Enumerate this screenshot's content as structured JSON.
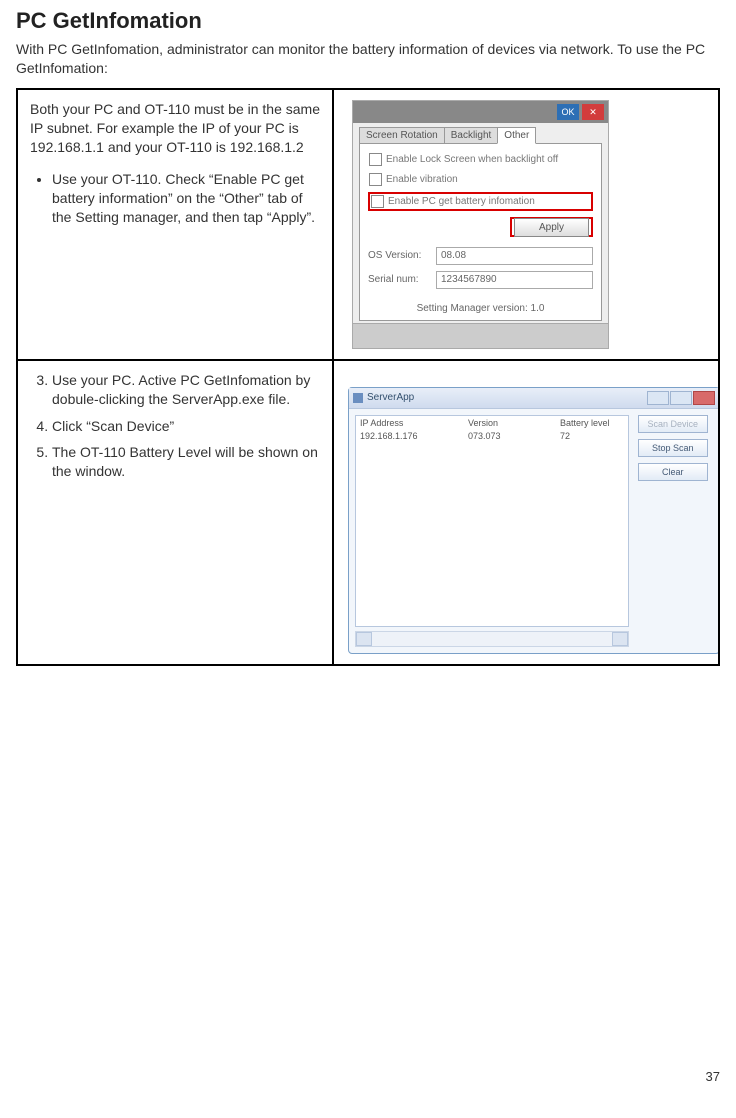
{
  "page": {
    "title": "PC GetInfomation",
    "lead": "With PC GetInfomation, administrator can monitor the battery information of devices via network. To use the PC GetInfomation:",
    "pageNumber": "37"
  },
  "row1": {
    "intro": "Both your PC and OT-110 must be in the same IP subnet. For example the IP of your PC is 192.168.1.1 and your OT-110 is 192.168.1.2",
    "bullet1": "Use your OT-110. Check “Enable PC get battery information” on the “Other” tab of the Setting manager, and then tap “Apply”."
  },
  "row2": {
    "step3": "Use your PC. Active PC GetInfomation by dobule-clicking the ServerApp.exe file.",
    "step4": "Click “Scan Device”",
    "step5": "The OT-110 Battery Level will be shown on the window."
  },
  "settingMgr": {
    "okLabel": "OK",
    "tab1": "Screen Rotation",
    "tab2": "Backlight",
    "tab3": "Other",
    "chkLockScreen": "Enable Lock Screen when backlight off",
    "chkVibration": "Enable vibration",
    "chkPCget": "Enable PC get battery infomation",
    "applyLabel": "Apply",
    "osverLabel": "OS Version:",
    "osverValue": "08.08",
    "serialLabel": "Serial num:",
    "serialValue": "1234567890",
    "mgrVersion": "Setting Manager version: 1.0"
  },
  "serverApp": {
    "title": "ServerApp",
    "colIp": "IP Address",
    "colVer": "Version",
    "colBat": "Battery level",
    "rowIp": "192.168.1.176",
    "rowVer": "073.073",
    "rowBat": "72",
    "btnScan": "Scan Device",
    "btnStop": "Stop Scan",
    "btnClear": "Clear"
  }
}
